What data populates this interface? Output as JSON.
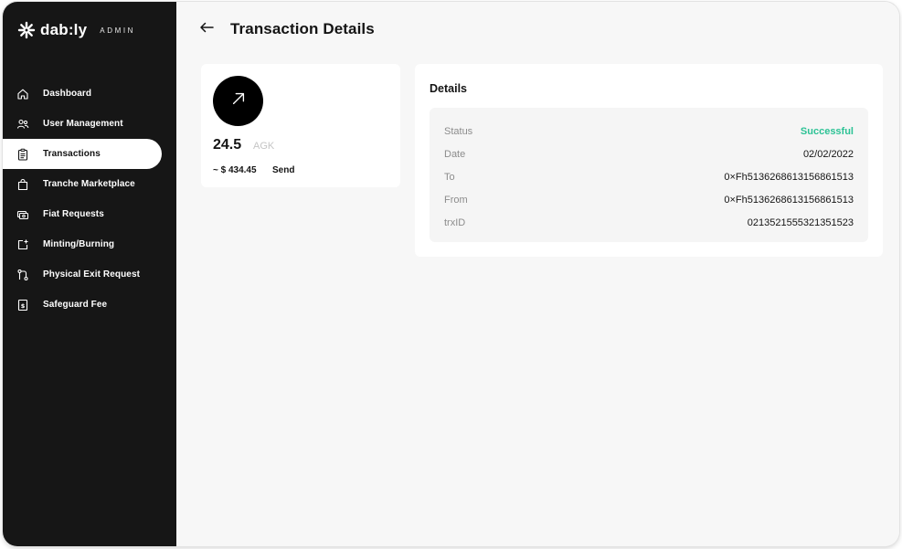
{
  "brand": {
    "name": "dab:ly",
    "tag": "ADMIN"
  },
  "sidebar": {
    "items": [
      {
        "label": "Dashboard",
        "icon": "home-icon",
        "active": false
      },
      {
        "label": "User Management",
        "icon": "users-icon",
        "active": false
      },
      {
        "label": "Transactions",
        "icon": "clipboard-icon",
        "active": true
      },
      {
        "label": "Tranche Marketplace",
        "icon": "shopping-bag-icon",
        "active": false
      },
      {
        "label": "Fiat Requests",
        "icon": "cash-icon",
        "active": false
      },
      {
        "label": "Minting/Burning",
        "icon": "mint-icon",
        "active": false
      },
      {
        "label": "Physical Exit Request",
        "icon": "route-icon",
        "active": false
      },
      {
        "label": "Safeguard Fee",
        "icon": "receipt-icon",
        "active": false
      }
    ]
  },
  "header": {
    "title": "Transaction Details",
    "back_icon": "arrow-left-icon"
  },
  "transaction": {
    "icon": "arrow-up-right-icon",
    "amount": "24.5",
    "unit": "AGK",
    "fiat": "~ $ 434.45",
    "type": "Send"
  },
  "details": {
    "title": "Details",
    "rows": [
      {
        "label": "Status",
        "value": "Successful"
      },
      {
        "label": "Date",
        "value": "02/02/2022"
      },
      {
        "label": "To",
        "value": "0×Fh5136268613156861513"
      },
      {
        "label": "From",
        "value": "0×Fh5136268613156861513"
      },
      {
        "label": "trxID",
        "value": "0213521555321351523"
      }
    ]
  },
  "colors": {
    "sidebar_bg": "#161616",
    "accent_success": "#2cc295",
    "page_bg": "#f7f7f7"
  }
}
